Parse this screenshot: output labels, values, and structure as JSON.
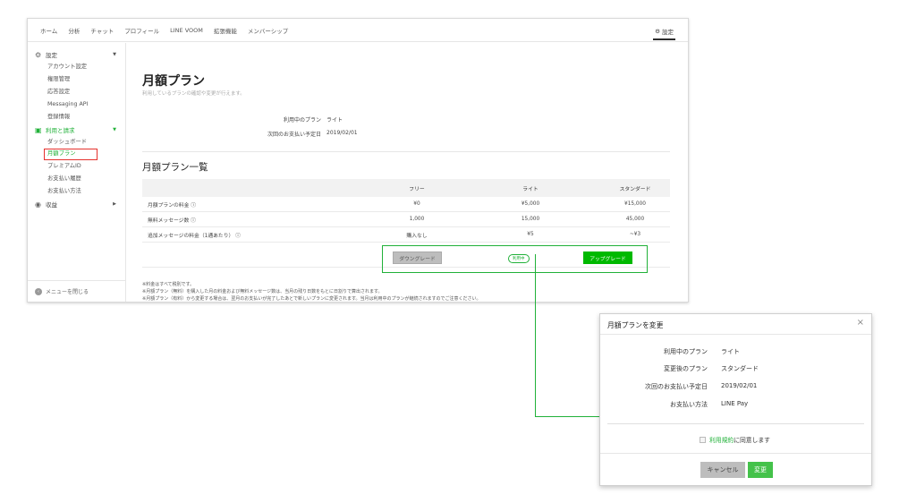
{
  "topnav": {
    "items": [
      "ホーム",
      "分析",
      "チャット",
      "プロフィール",
      "LINE VOOM",
      "拡張機能",
      "メンバーシップ"
    ],
    "settings_label": "設定"
  },
  "sidebar": {
    "settings_group": "設定",
    "settings_items": [
      "アカウント設定",
      "権限管理",
      "応答設定",
      "Messaging API",
      "登録情報"
    ],
    "billing_group": "利用と請求",
    "billing_items": [
      "ダッシュボード",
      "月額プラン",
      "プレミアムID",
      "お支払い履歴",
      "お支払い方法"
    ],
    "revenue_group": "収益",
    "footer": "メニューを閉じる"
  },
  "main": {
    "title": "月額プラン",
    "subtitle": "利用しているプランの確認や変更が行えます。",
    "current_plan_label": "利用中のプラン",
    "current_plan_value": "ライト",
    "next_payment_label": "次回のお支払い予定日",
    "next_payment_value": "2019/02/01",
    "section_title": "月額プラン一覧",
    "table": {
      "headers": [
        "フリー",
        "ライト",
        "スタンダード"
      ],
      "rows": [
        {
          "label": "月額プランの料金 ⓘ",
          "values": [
            "¥0",
            "¥5,000",
            "¥15,000"
          ]
        },
        {
          "label": "無料メッセージ数 ⓘ",
          "values": [
            "1,000",
            "15,000",
            "45,000"
          ]
        },
        {
          "label": "追加メッセージの料金（1通あたり） ⓘ",
          "values": [
            "購入なし",
            "¥5",
            "~¥3"
          ]
        }
      ]
    },
    "downgrade_label": "ダウングレード",
    "current_badge": "利用中",
    "upgrade_label": "アップグレード",
    "notes": [
      "※料金はすべて税別です。",
      "※月額プラン（無料）を購入した月の料金および無料メッセージ数は、当月の残り日数をもとに日割りで算出されます。",
      "※月額プラン（有料）から変更する場合は、翌月のお支払いが完了したあとで新しいプランに変更されます。当月は利用中のプランが継続されますのでご注意ください。"
    ]
  },
  "dialog": {
    "title": "月額プランを変更",
    "close": "×",
    "rows": [
      {
        "label": "利用中のプラン",
        "value": "ライト"
      },
      {
        "label": "変更後のプラン",
        "value": "スタンダード"
      },
      {
        "label": "次回のお支払い予定日",
        "value": "2019/02/01"
      },
      {
        "label": "お支払い方法",
        "value": "LINE Pay"
      }
    ],
    "agree_link": "利用規約",
    "agree_rest": "に同意します",
    "cancel_label": "キャンセル",
    "change_label": "変更"
  },
  "colors": {
    "accent": "#00b900",
    "highlight": "#21b139",
    "active_outline": "#e5322d"
  }
}
